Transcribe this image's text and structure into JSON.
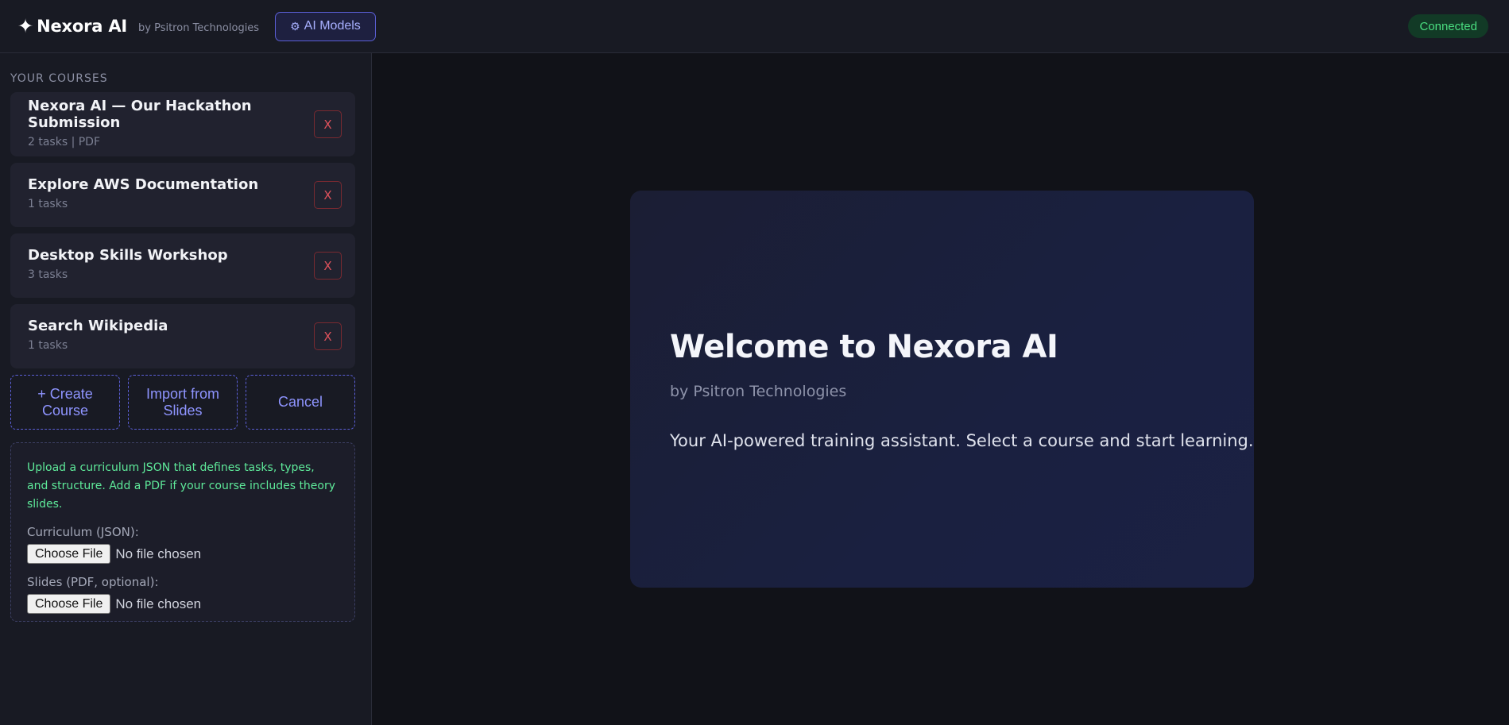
{
  "header": {
    "brand_icon": "sparkle-icon",
    "star": "✦",
    "title": "Nexora AI",
    "subtitle": "by Psitron Technologies",
    "models_button_icon": "gear-icon",
    "models_button_glyph": "⚙",
    "models_button_label": "AI Models",
    "status": "Connected",
    "status_color": "#4ade80",
    "accent_color": "#5b5fd6"
  },
  "sidebar": {
    "heading": "YOUR COURSES",
    "courses": [
      {
        "title": "Nexora AI — Our Hackathon Submission",
        "meta": "2 tasks | PDF",
        "remove_label": "X"
      },
      {
        "title": "Explore AWS Documentation",
        "meta": "1 tasks",
        "remove_label": "X"
      },
      {
        "title": "Desktop Skills Workshop",
        "meta": "3 tasks",
        "remove_label": "X"
      },
      {
        "title": "Search Wikipedia",
        "meta": "1 tasks",
        "remove_label": "X"
      }
    ],
    "actions": {
      "create": "+ Create Course",
      "import": "Import from Slides",
      "cancel": "Cancel"
    },
    "upload": {
      "help": "Upload a curriculum JSON that defines tasks, types, and structure. Add a PDF if your course includes theory slides.",
      "curriculum_label": "Curriculum (JSON):",
      "curriculum_button": "Choose File",
      "curriculum_status": "No file chosen",
      "slides_label": "Slides (PDF, optional):",
      "slides_button": "Choose File",
      "slides_status": "No file chosen"
    }
  },
  "main": {
    "welcome_title": "Welcome to Nexora AI",
    "welcome_subtitle": "by Psitron Technologies",
    "welcome_text": "Your AI-powered training assistant. Select a course and start learning."
  }
}
